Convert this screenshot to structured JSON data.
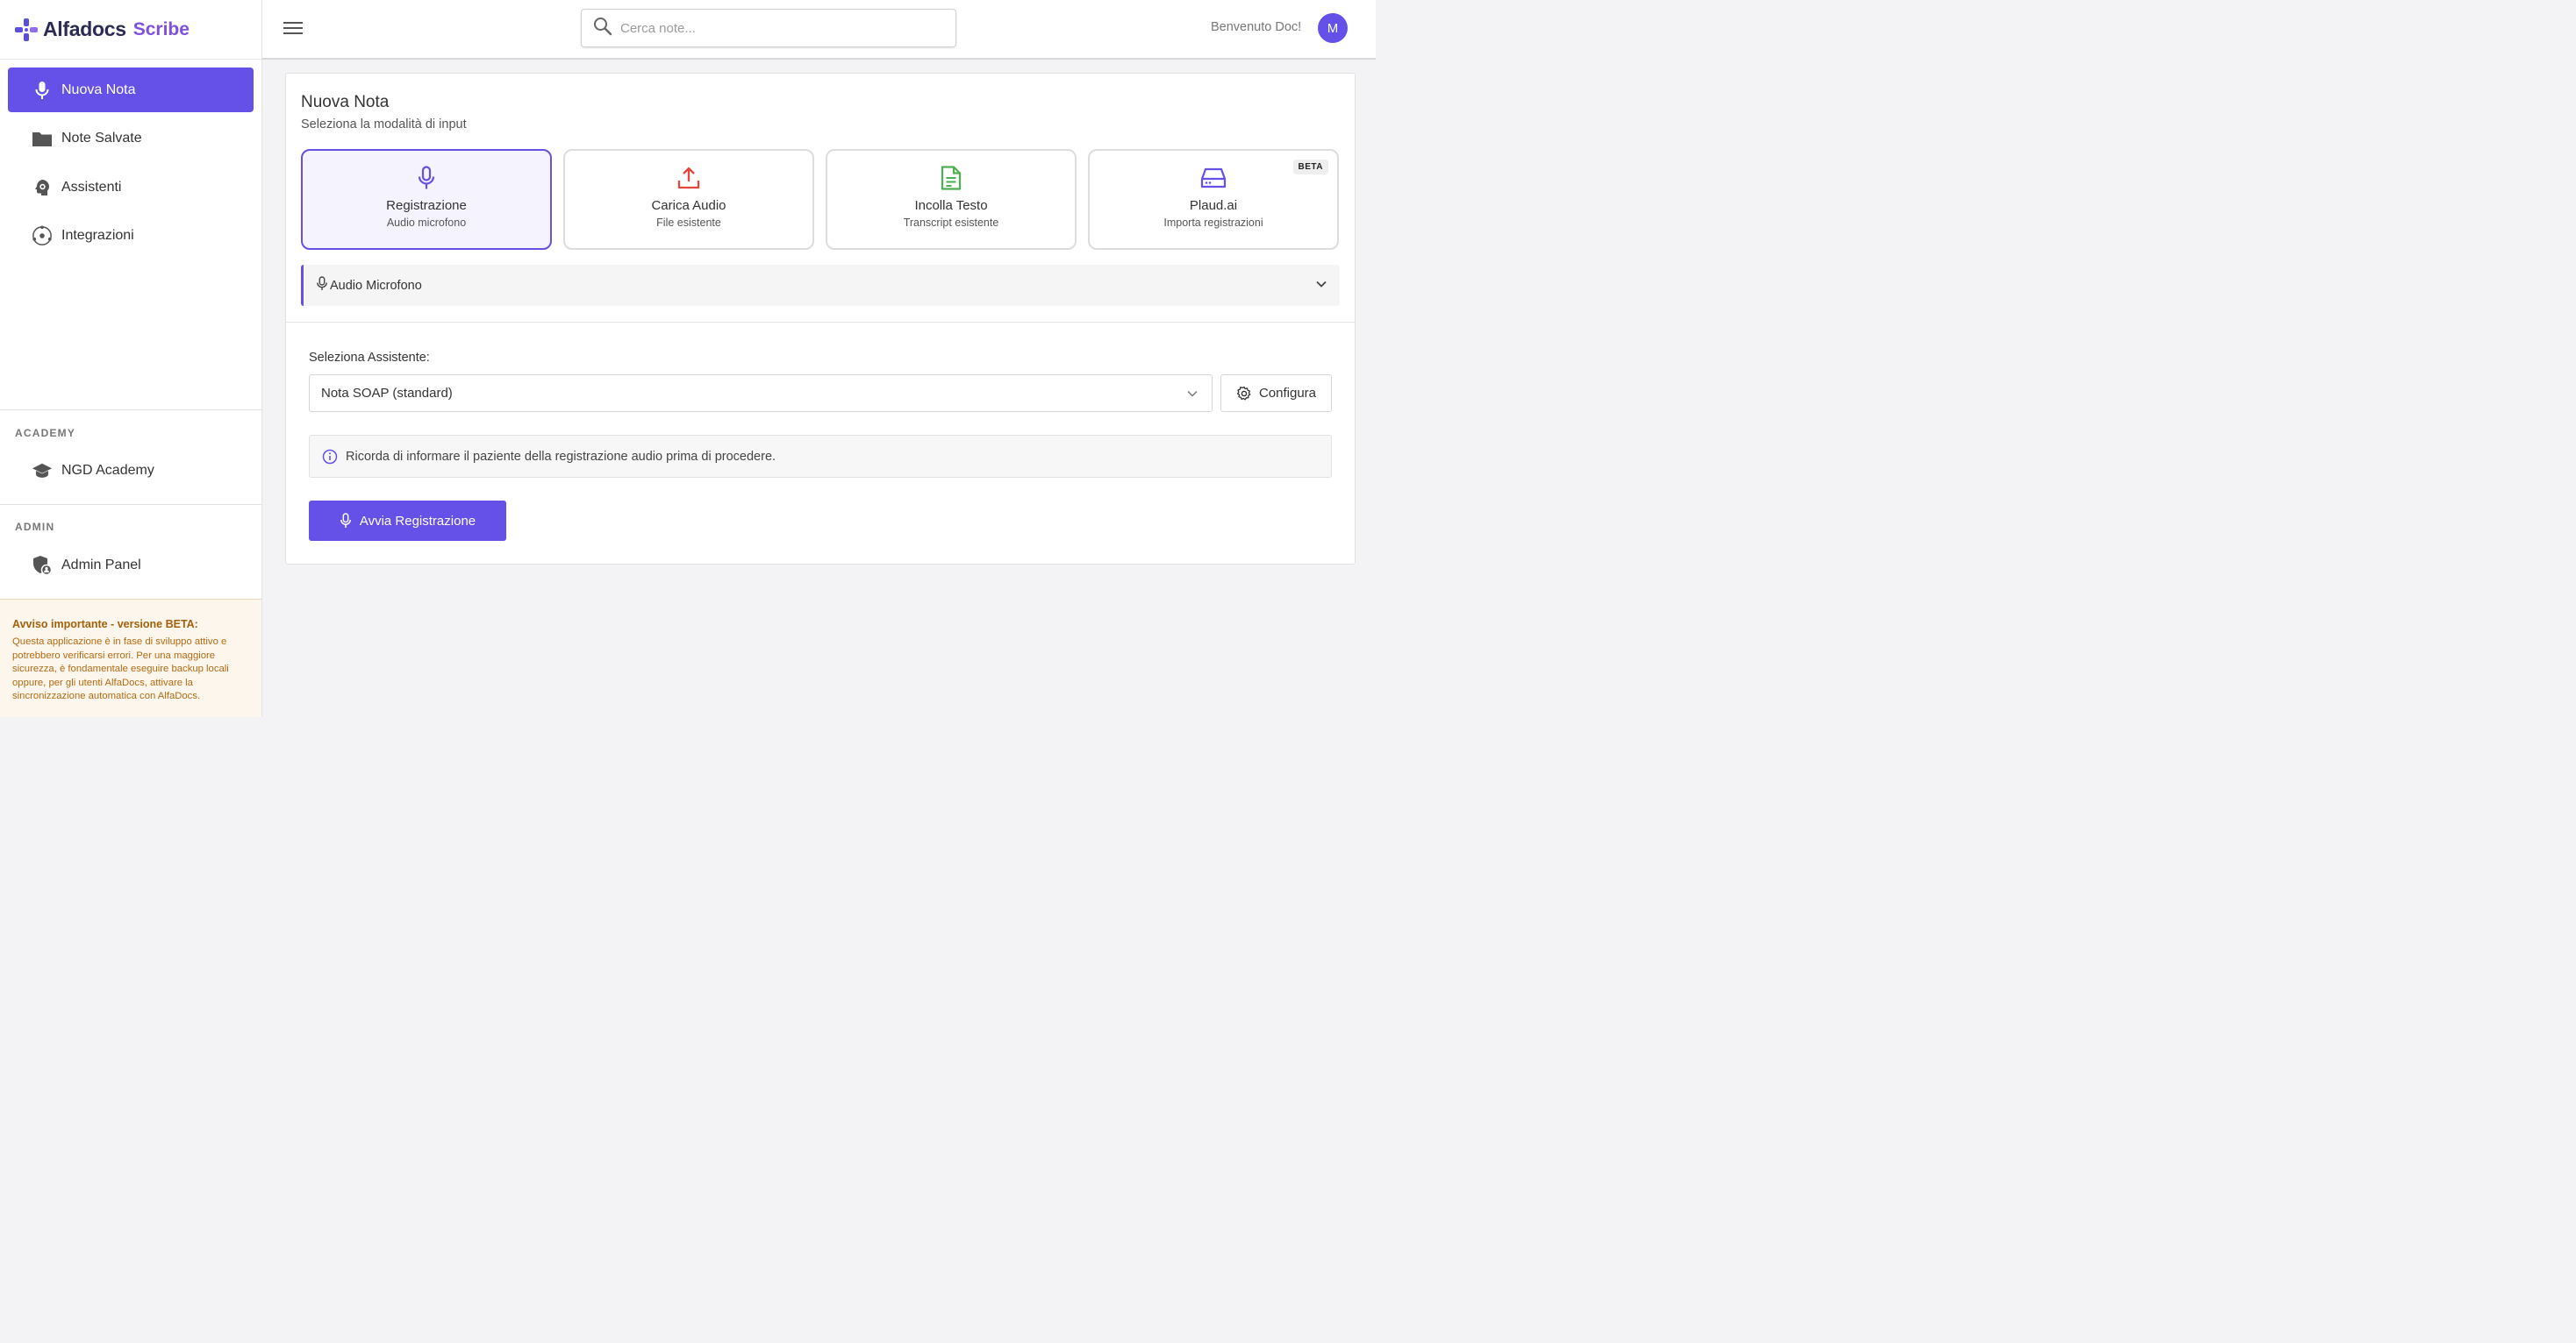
{
  "brand": {
    "name": "Alfadocs",
    "product": "Scribe",
    "accent": "#6550e8"
  },
  "sidebar": {
    "items": [
      {
        "label": "Nuova Nota",
        "icon": "microphone-icon",
        "active": true
      },
      {
        "label": "Note Salvate",
        "icon": "folder-icon",
        "active": false
      },
      {
        "label": "Assistenti",
        "icon": "assistant-gear-icon",
        "active": false
      },
      {
        "label": "Integrazioni",
        "icon": "integration-icon",
        "active": false
      }
    ],
    "academy": {
      "title": "ACADEMY",
      "item": {
        "label": "NGD Academy",
        "icon": "graduation-cap-icon"
      }
    },
    "admin": {
      "title": "ADMIN",
      "item": {
        "label": "Admin Panel",
        "icon": "shield-user-icon"
      }
    },
    "notice": {
      "title": "Avviso importante - versione BETA:",
      "text": "Questa applicazione è in fase di sviluppo attivo e potrebbero verificarsi errori. Per una maggiore sicurezza, è fondamentale eseguire backup locali oppure, per gli utenti AlfaDocs, attivare la sincronizzazione automatica con AlfaDocs."
    }
  },
  "header": {
    "search_placeholder": "Cerca note...",
    "welcome": "Benvenuto Doc!",
    "avatar_initial": "M"
  },
  "main": {
    "title": "Nuova Nota",
    "subtitle": "Seleziona la modalità di input",
    "modes": [
      {
        "title": "Registrazione",
        "sub": "Audio microfono",
        "icon": "microphone-icon",
        "color": "#6550e8",
        "selected": true
      },
      {
        "title": "Carica Audio",
        "sub": "File esistente",
        "icon": "upload-icon",
        "color": "#e8453c",
        "selected": false
      },
      {
        "title": "Incolla Testo",
        "sub": "Transcript esistente",
        "icon": "document-icon",
        "color": "#4caf50",
        "selected": false
      },
      {
        "title": "Plaud.ai",
        "sub": "Importa registrazioni",
        "icon": "drive-icon",
        "color": "#6550e8",
        "selected": false,
        "badge": "BETA"
      }
    ],
    "accordion_label": "Audio Microfono",
    "assistant_label": "Seleziona Assistente:",
    "assistant_value": "Nota SOAP (standard)",
    "configure_label": "Configura",
    "info_text": "Ricorda di informare il paziente della registrazione audio prima di procedere.",
    "start_label": "Avvia Registrazione"
  }
}
